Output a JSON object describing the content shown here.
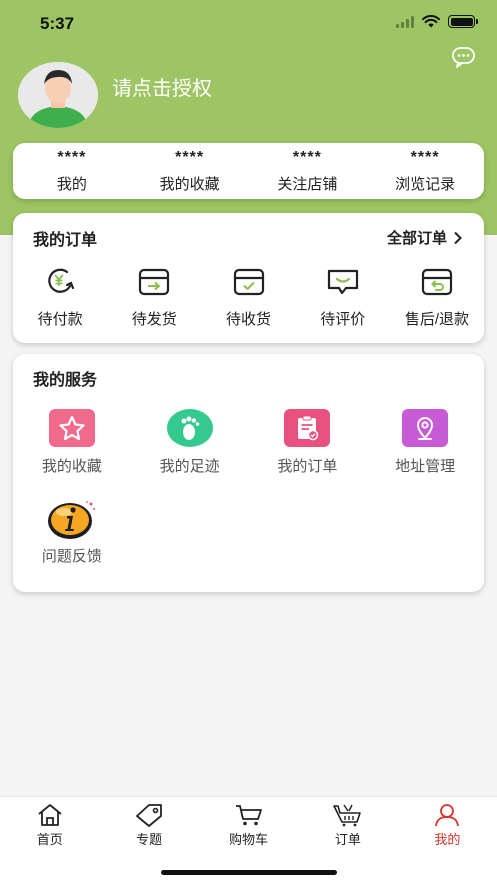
{
  "status_bar": {
    "time": "5:37"
  },
  "profile": {
    "login_prompt": "请点击授权"
  },
  "stats": [
    {
      "value": "****",
      "label": "我的"
    },
    {
      "value": "****",
      "label": "我的收藏"
    },
    {
      "value": "****",
      "label": "关注店铺"
    },
    {
      "value": "****",
      "label": "浏览记录"
    }
  ],
  "orders": {
    "title": "我的订单",
    "all_label": "全部订单",
    "items": [
      {
        "label": "待付款",
        "icon": "wallet-yen-icon"
      },
      {
        "label": "待发货",
        "icon": "box-arrow-icon"
      },
      {
        "label": "待收货",
        "icon": "box-check-icon"
      },
      {
        "label": "待评价",
        "icon": "comment-icon"
      },
      {
        "label": "售后/退款",
        "icon": "box-return-icon"
      }
    ]
  },
  "services": {
    "title": "我的服务",
    "items": [
      {
        "label": "我的收藏",
        "icon": "star-icon",
        "color": "#f06a8c"
      },
      {
        "label": "我的足迹",
        "icon": "footprint-icon",
        "color": "#34c98e"
      },
      {
        "label": "我的订单",
        "icon": "clipboard-icon",
        "color": "#e8507f"
      },
      {
        "label": "地址管理",
        "icon": "location-pin-icon",
        "color": "#c75bd6"
      },
      {
        "label": "问题反馈",
        "icon": "info-icon",
        "color": "#f5a623"
      }
    ]
  },
  "tabbar": {
    "items": [
      {
        "label": "首页",
        "icon": "home-icon",
        "active": false
      },
      {
        "label": "专题",
        "icon": "tag-icon",
        "active": false
      },
      {
        "label": "购物车",
        "icon": "cart-icon",
        "active": false
      },
      {
        "label": "订单",
        "icon": "basket-icon",
        "active": false
      },
      {
        "label": "我的",
        "icon": "user-icon",
        "active": true
      }
    ]
  },
  "colors": {
    "header": "#9dc563",
    "active_tab": "#d9342b"
  }
}
